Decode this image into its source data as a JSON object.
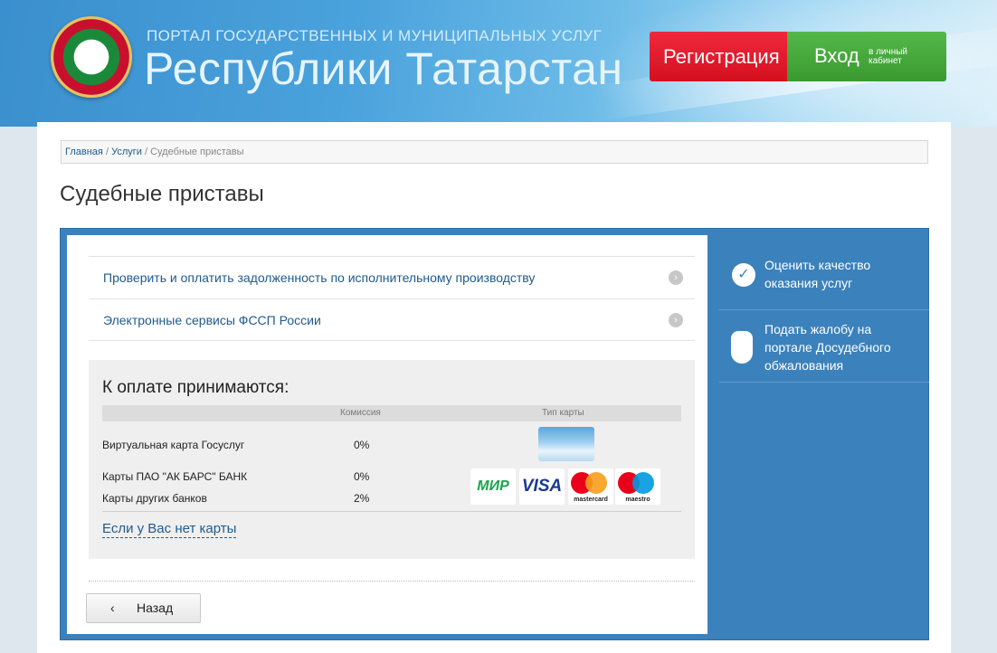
{
  "header": {
    "portal_subtitle": "ПОРТАЛ ГОСУДАРСТВЕННЫХ И МУНИЦИПАЛЬНЫХ УСЛУГ",
    "portal_title": "Республики Татарстан",
    "register_label": "Регистрация",
    "login_label": "Вход",
    "login_sub": "в личный кабинет"
  },
  "breadcrumb": {
    "home": "Главная",
    "sep": "/",
    "services": "Услуги",
    "current": "Судебные приставы"
  },
  "page_title": "Судебные приставы",
  "services": [
    {
      "label": "Проверить и оплатить задолженность по исполнительному производству",
      "arrow": "›"
    },
    {
      "label": "Электронные сервисы ФССП России",
      "arrow": "›"
    }
  ],
  "payment": {
    "title": "К оплате принимаются:",
    "col_commission": "Комиссия",
    "col_card_type": "Тип карты",
    "rows": [
      {
        "name": "Виртуальная карта Госуслуг",
        "pct": "0%"
      },
      {
        "name": "Карты ПАО \"АК БАРС\" БАНК",
        "pct": "0%"
      },
      {
        "name": "Карты других банков",
        "pct": "2%"
      }
    ],
    "logos": {
      "mir": "МИР",
      "visa": "VISA",
      "mastercard": "mastercard",
      "maestro": "maestro"
    },
    "no_card_link": "Если у Вас нет карты"
  },
  "back_label": "Назад",
  "back_icon": "‹",
  "sidebar": {
    "items": [
      {
        "label": "Оценить качество оказания услуг",
        "icon": "check-icon"
      },
      {
        "label": "Подать жалобу на портале Досудебного обжалования",
        "icon": "hand-icon"
      }
    ]
  },
  "colors": {
    "accent_blue": "#3b82bc",
    "register_red": "#e01a2d",
    "login_green": "#4aab3d",
    "link": "#1f5a8c"
  }
}
